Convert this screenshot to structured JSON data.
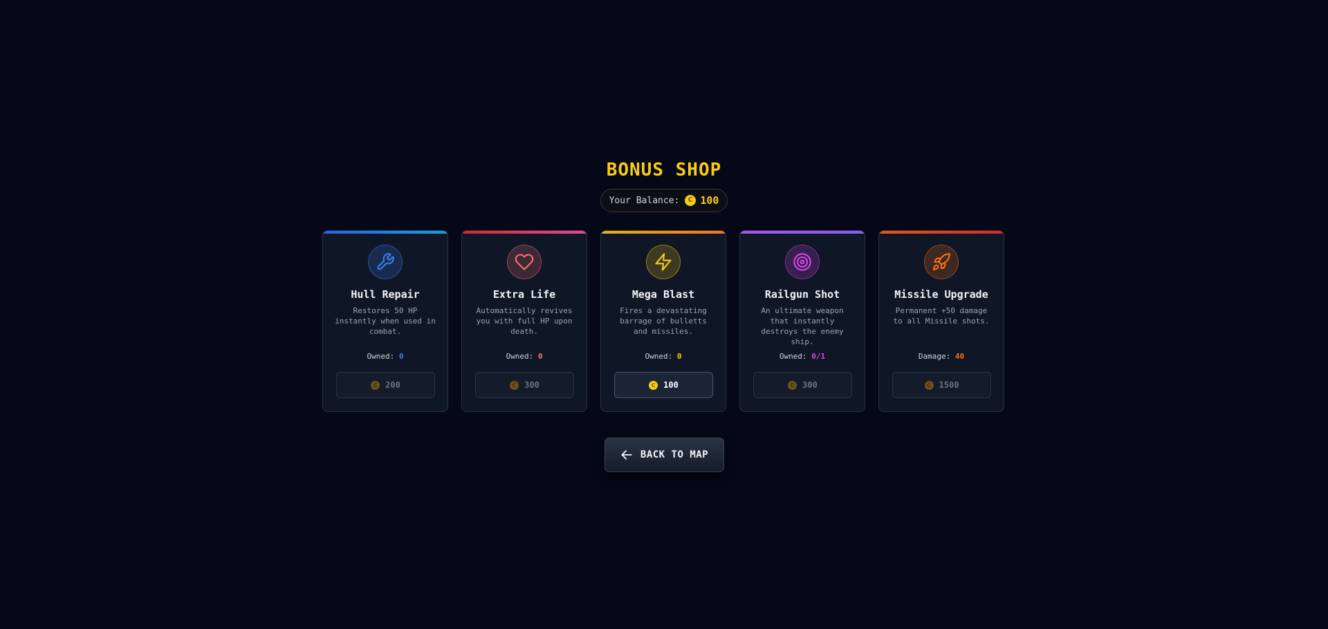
{
  "title": "BONUS SHOP",
  "balance": {
    "label": "Your Balance:",
    "coin_symbol": "C",
    "amount": "100"
  },
  "colors": {
    "gold": "#facc15",
    "background": "#050816"
  },
  "items": [
    {
      "name": "Hull Repair",
      "description": "Restores 50 HP instantly when used in combat.",
      "stat_label": "Owned:",
      "stat_value": "0",
      "price": "200",
      "affordable": false,
      "icon": "wrench-icon",
      "accent": "#3b82f6",
      "bar_gradient": [
        "#2563eb",
        "#0ea5e9"
      ]
    },
    {
      "name": "Extra Life",
      "description": "Automatically revives you with full HP upon death.",
      "stat_label": "Owned:",
      "stat_value": "0",
      "price": "300",
      "affordable": false,
      "icon": "heart-icon",
      "accent": "#f87171",
      "bar_gradient": [
        "#dc2626",
        "#ec4899"
      ]
    },
    {
      "name": "Mega Blast",
      "description": "Fires a devastating barrage of bulletts and missiles.",
      "stat_label": "Owned:",
      "stat_value": "0",
      "price": "100",
      "affordable": true,
      "icon": "lightning-icon",
      "accent": "#facc15",
      "bar_gradient": [
        "#eab308",
        "#f97316"
      ]
    },
    {
      "name": "Railgun Shot",
      "description": "An ultimate weapon that instantly destroys the enemy ship.",
      "stat_label": "Owned:",
      "stat_value": "0/1",
      "price": "300",
      "affordable": false,
      "icon": "target-icon",
      "accent": "#d946ef",
      "bar_gradient": [
        "#a855f7",
        "#8b5cf6"
      ]
    },
    {
      "name": "Missile Upgrade",
      "description": "Permanent +50 damage to all Missile shots.",
      "stat_label": "Damage:",
      "stat_value": "40",
      "price": "1500",
      "affordable": false,
      "icon": "rocket-icon",
      "accent": "#f97316",
      "bar_gradient": [
        "#ea580c",
        "#dc2626"
      ]
    }
  ],
  "back_button": {
    "label": "BACK TO MAP",
    "icon": "arrow-left-icon"
  }
}
